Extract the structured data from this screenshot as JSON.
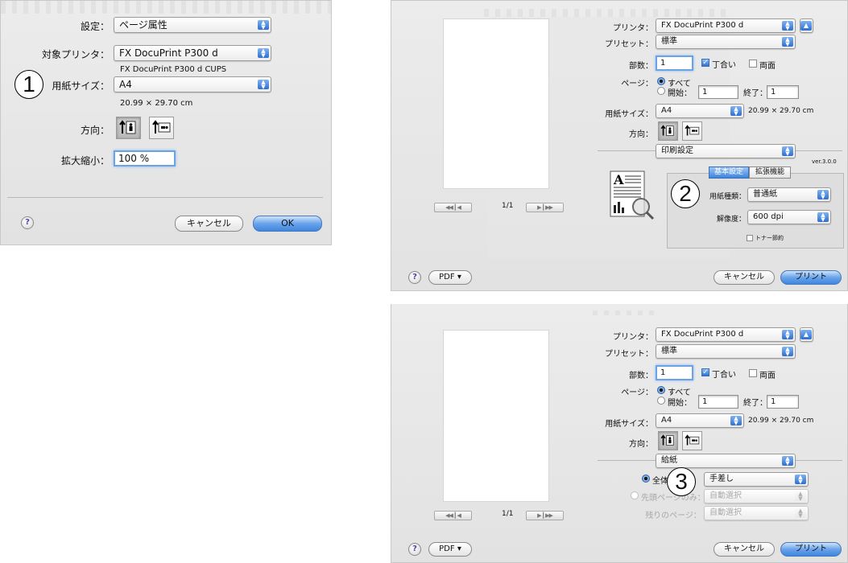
{
  "markers": {
    "one": "1",
    "two": "2",
    "three": "3"
  },
  "page_setup": {
    "settings_label": "設定：",
    "settings_value": "ページ属性",
    "format_for_label": "対象プリンタ：",
    "format_for_value": "FX DocuPrint P300 d",
    "format_for_sub": "FX DocuPrint P300 d CUPS",
    "paper_size_label": "用紙サイズ：",
    "paper_size_value": "A4",
    "paper_dims": "20.99 × 29.70 cm",
    "orientation_label": "方向：",
    "scale_label": "拡大縮小：",
    "scale_value": "100 %",
    "help": "?",
    "cancel": "キャンセル",
    "ok": "OK"
  },
  "print_dialog_top": {
    "printer_label": "プリンタ：",
    "printer_value": "FX DocuPrint P300 d",
    "preset_label": "プリセット：",
    "preset_value": "標準",
    "copies_label": "部数：",
    "copies_value": "1",
    "collated_label": "丁合い",
    "two_sided_label": "両面",
    "pages_label": "ページ：",
    "all_label": "すべて",
    "from_label": "開始：",
    "from_value": "1",
    "to_label": "終了：",
    "to_value": "1",
    "paper_size_label": "用紙サイズ：",
    "paper_size_value": "A4",
    "paper_dims": "20.99 × 29.70 cm",
    "orientation_label": "方向：",
    "section_value": "印刷設定",
    "version": "ver.3.0.0",
    "tab_basic": "基本設定",
    "tab_advanced": "拡張機能",
    "media_type_label": "用紙種類：",
    "media_type_value": "普通紙",
    "resolution_label": "解像度：",
    "resolution_value": "600 dpi",
    "toner_save_label": "トナー節約",
    "page_count": "1/1",
    "help": "?",
    "pdf": "PDF ▾",
    "cancel": "キャンセル",
    "print": "プリント"
  },
  "print_dialog_bottom": {
    "printer_label": "プリンタ：",
    "printer_value": "FX DocuPrint P300 d",
    "preset_label": "プリセット：",
    "preset_value": "標準",
    "copies_label": "部数：",
    "copies_value": "1",
    "collated_label": "丁合い",
    "two_sided_label": "両面",
    "pages_label": "ページ：",
    "all_label": "すべて",
    "from_label": "開始：",
    "from_value": "1",
    "to_label": "終了：",
    "to_value": "1",
    "paper_size_label": "用紙サイズ：",
    "paper_size_value": "A4",
    "paper_dims": "20.99 × 29.70 cm",
    "orientation_label": "方向：",
    "section_value": "給紙",
    "all_pages_from_label": "全体：",
    "all_pages_from_value": "手差し",
    "first_page_label": "先頭ページのみ：",
    "first_page_value": "自動選択",
    "remaining_label": "残りのページ：",
    "remaining_value": "自動選択",
    "page_count": "1/1",
    "help": "?",
    "pdf": "PDF ▾",
    "cancel": "キャンセル",
    "print": "プリント"
  }
}
